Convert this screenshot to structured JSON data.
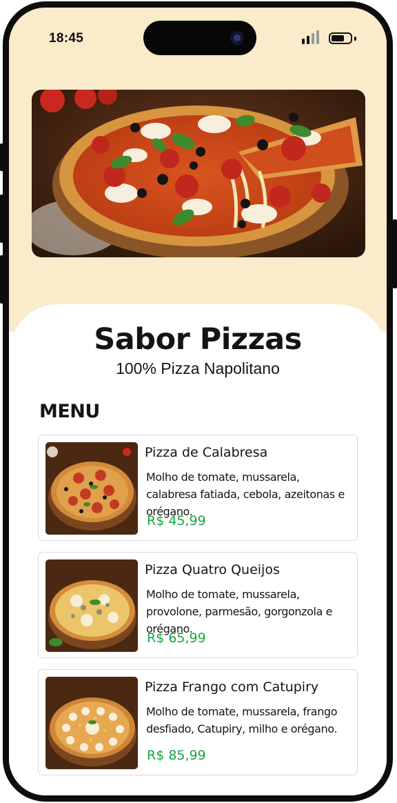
{
  "status_bar": {
    "time": "18:45"
  },
  "hero": {
    "icon": "pizza-photo"
  },
  "header": {
    "title": "Sabor Pizzas",
    "subtitle": "100% Pizza Napolitano"
  },
  "menu": {
    "heading": "MENU",
    "items": [
      {
        "name": "Pizza de Calabresa",
        "description": "Molho de tomate, mussarela, calabresa fatiada, cebola, azeitonas e orégano.",
        "price": "R$ 45,99"
      },
      {
        "name": "Pizza Quatro Queijos",
        "description": "Molho de tomate, mussarela, provolone, parmesão, gorgonzola e orégano.",
        "price": "R$ 65,99"
      },
      {
        "name": "Pizza Frango com Catupiry",
        "description": "Molho de tomate, mussarela, frango desfiado, Catupiry, milho e orégano.",
        "price": "R$ 85,99"
      }
    ]
  },
  "colors": {
    "header_bg": "#faebcb",
    "price": "#17a43f",
    "frame": "#0d0d0d"
  }
}
